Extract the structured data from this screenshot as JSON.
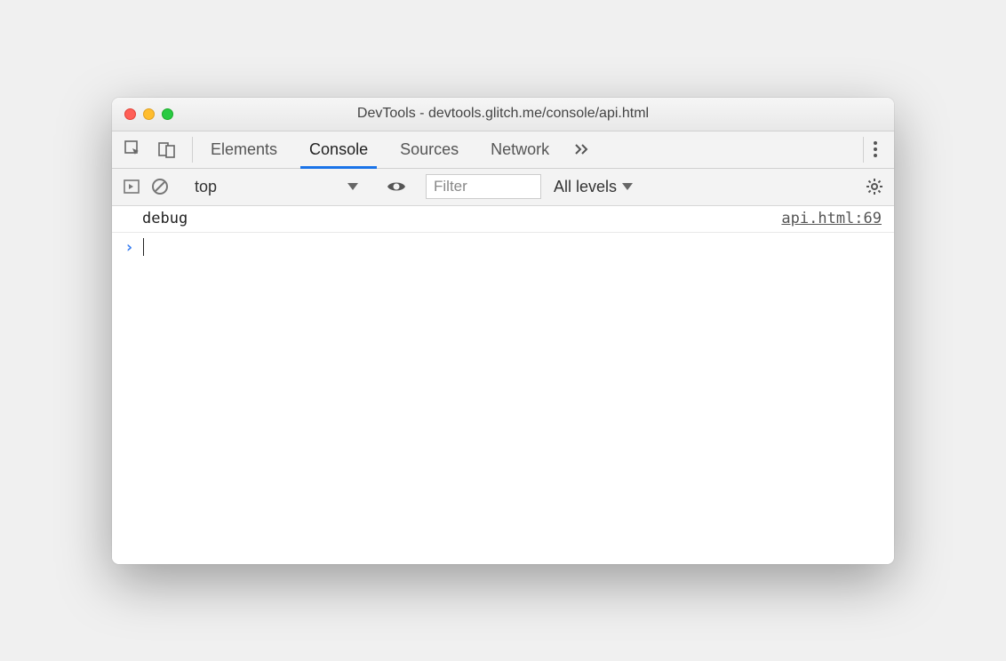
{
  "window": {
    "title": "DevTools - devtools.glitch.me/console/api.html"
  },
  "tabs": {
    "elements": "Elements",
    "console": "Console",
    "sources": "Sources",
    "network": "Network"
  },
  "subbar": {
    "context": "top",
    "filter_placeholder": "Filter",
    "levels": "All levels"
  },
  "log": {
    "message": "debug",
    "source": "api.html:69"
  }
}
